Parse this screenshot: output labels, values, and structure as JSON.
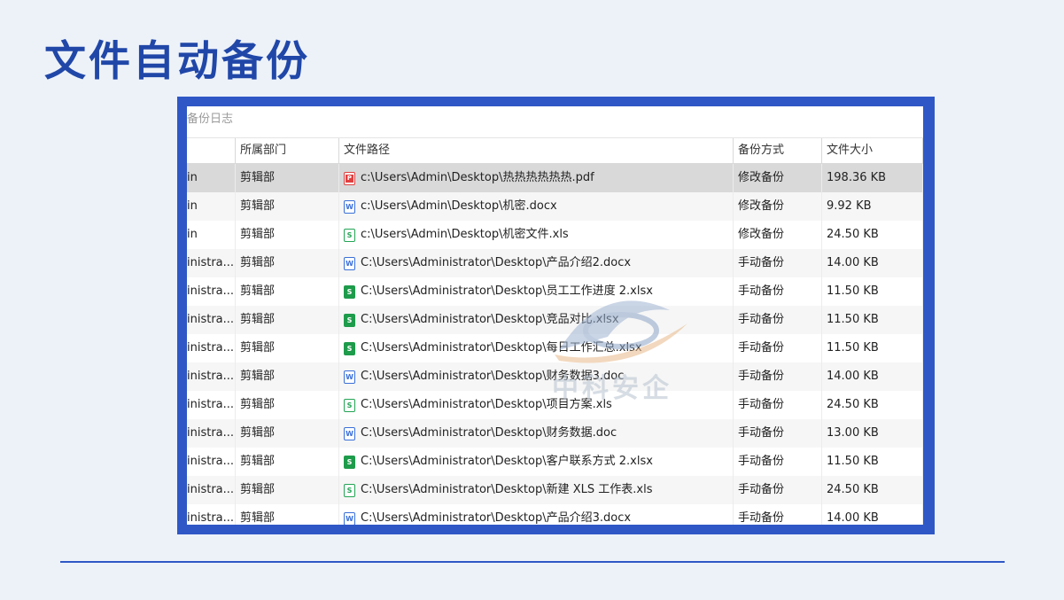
{
  "slide": {
    "title": "文件自动备份"
  },
  "window": {
    "title": "备份日志"
  },
  "table": {
    "columns": [
      "",
      "所属部门",
      "文件路径",
      "备份方式",
      "文件大小"
    ],
    "rows": [
      {
        "user": "in",
        "dept": "剪辑部",
        "type": "pdf",
        "path": "c:\\Users\\Admin\\Desktop\\热热热热热热.pdf",
        "mode": "修改备份",
        "size": "198.36 KB"
      },
      {
        "user": "in",
        "dept": "剪辑部",
        "type": "doc",
        "path": "c:\\Users\\Admin\\Desktop\\机密.docx",
        "mode": "修改备份",
        "size": "9.92 KB"
      },
      {
        "user": "in",
        "dept": "剪辑部",
        "type": "xls",
        "path": "c:\\Users\\Admin\\Desktop\\机密文件.xls",
        "mode": "修改备份",
        "size": "24.50 KB"
      },
      {
        "user": "inistra...",
        "dept": "剪辑部",
        "type": "doc",
        "path": "C:\\Users\\Administrator\\Desktop\\产品介绍2.docx",
        "mode": "手动备份",
        "size": "14.00 KB"
      },
      {
        "user": "inistra...",
        "dept": "剪辑部",
        "type": "xlsx",
        "path": "C:\\Users\\Administrator\\Desktop\\员工工作进度 2.xlsx",
        "mode": "手动备份",
        "size": "11.50 KB"
      },
      {
        "user": "inistra...",
        "dept": "剪辑部",
        "type": "xlsx",
        "path": "C:\\Users\\Administrator\\Desktop\\竞品对比.xlsx",
        "mode": "手动备份",
        "size": "11.50 KB"
      },
      {
        "user": "inistra...",
        "dept": "剪辑部",
        "type": "xlsx",
        "path": "C:\\Users\\Administrator\\Desktop\\每日工作汇总.xlsx",
        "mode": "手动备份",
        "size": "11.50 KB"
      },
      {
        "user": "inistra...",
        "dept": "剪辑部",
        "type": "doc",
        "path": "C:\\Users\\Administrator\\Desktop\\财务数据3.doc",
        "mode": "手动备份",
        "size": "14.00 KB"
      },
      {
        "user": "inistra...",
        "dept": "剪辑部",
        "type": "xls",
        "path": "C:\\Users\\Administrator\\Desktop\\项目方案.xls",
        "mode": "手动备份",
        "size": "24.50 KB"
      },
      {
        "user": "inistra...",
        "dept": "剪辑部",
        "type": "doc",
        "path": "C:\\Users\\Administrator\\Desktop\\财务数据.doc",
        "mode": "手动备份",
        "size": "13.00 KB"
      },
      {
        "user": "inistra...",
        "dept": "剪辑部",
        "type": "xlsx",
        "path": "C:\\Users\\Administrator\\Desktop\\客户联系方式 2.xlsx",
        "mode": "手动备份",
        "size": "11.50 KB"
      },
      {
        "user": "inistra...",
        "dept": "剪辑部",
        "type": "xls",
        "path": "C:\\Users\\Administrator\\Desktop\\新建 XLS 工作表.xls",
        "mode": "手动备份",
        "size": "24.50 KB"
      },
      {
        "user": "inistra...",
        "dept": "剪辑部",
        "type": "doc",
        "path": "C:\\Users\\Administrator\\Desktop\\产品介绍3.docx",
        "mode": "手动备份",
        "size": "14.00 KB"
      }
    ]
  },
  "watermark": {
    "text": "中科安企"
  },
  "colors": {
    "title": "#2047a8",
    "frame": "#2f58c6",
    "background": "#edf2f9"
  }
}
